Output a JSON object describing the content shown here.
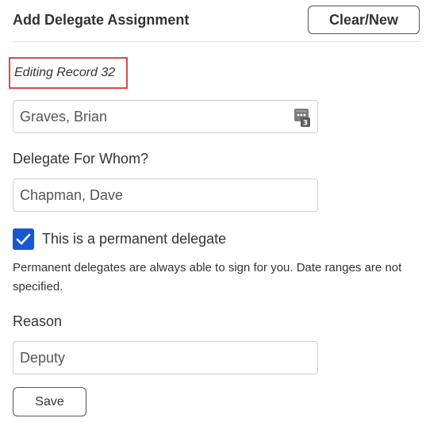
{
  "header": {
    "title": "Add Delegate Assignment",
    "clear_new_label": "Clear/New"
  },
  "editing_status": "Editing Record 32",
  "delegate_field": {
    "value": "Graves, Brian",
    "icon": "contact-card-icon"
  },
  "for_whom": {
    "label": "Delegate For Whom?",
    "value": "Chapman, Dave"
  },
  "permanent": {
    "checked": true,
    "label": "This is a permanent delegate",
    "help": "Permanent delegates are always able to sign for you. Date ranges are not specified."
  },
  "reason": {
    "label": "Reason",
    "value": "Deputy"
  },
  "save_label": "Save",
  "colors": {
    "accent": "#1757d1",
    "highlight_border": "#e0484a"
  }
}
